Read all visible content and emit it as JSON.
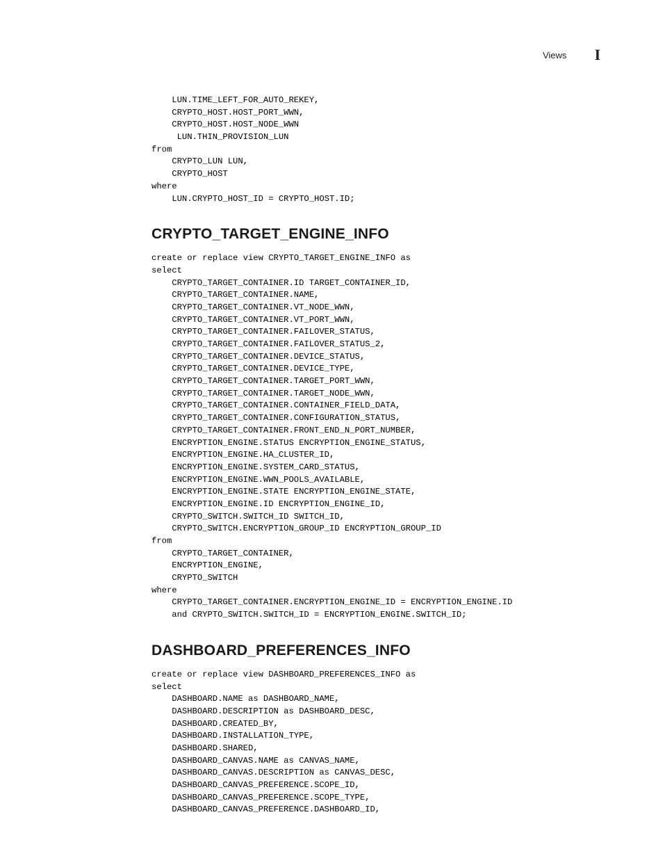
{
  "header": {
    "label": "Views",
    "badge": "I"
  },
  "block1": "    LUN.TIME_LEFT_FOR_AUTO_REKEY,\n    CRYPTO_HOST.HOST_PORT_WWN,\n    CRYPTO_HOST.HOST_NODE_WWN\n     LUN.THIN_PROVISION_LUN\nfrom\n    CRYPTO_LUN LUN,\n    CRYPTO_HOST\nwhere\n    LUN.CRYPTO_HOST_ID = CRYPTO_HOST.ID;",
  "heading1": "CRYPTO_TARGET_ENGINE_INFO",
  "block2": "create or replace view CRYPTO_TARGET_ENGINE_INFO as\nselect\n    CRYPTO_TARGET_CONTAINER.ID TARGET_CONTAINER_ID,\n    CRYPTO_TARGET_CONTAINER.NAME,\n    CRYPTO_TARGET_CONTAINER.VT_NODE_WWN,\n    CRYPTO_TARGET_CONTAINER.VT_PORT_WWN,\n    CRYPTO_TARGET_CONTAINER.FAILOVER_STATUS,\n    CRYPTO_TARGET_CONTAINER.FAILOVER_STATUS_2,\n    CRYPTO_TARGET_CONTAINER.DEVICE_STATUS,\n    CRYPTO_TARGET_CONTAINER.DEVICE_TYPE,\n    CRYPTO_TARGET_CONTAINER.TARGET_PORT_WWN,\n    CRYPTO_TARGET_CONTAINER.TARGET_NODE_WWN,\n    CRYPTO_TARGET_CONTAINER.CONTAINER_FIELD_DATA,\n    CRYPTO_TARGET_CONTAINER.CONFIGURATION_STATUS,\n    CRYPTO_TARGET_CONTAINER.FRONT_END_N_PORT_NUMBER,\n    ENCRYPTION_ENGINE.STATUS ENCRYPTION_ENGINE_STATUS,\n    ENCRYPTION_ENGINE.HA_CLUSTER_ID,\n    ENCRYPTION_ENGINE.SYSTEM_CARD_STATUS,\n    ENCRYPTION_ENGINE.WWN_POOLS_AVAILABLE,\n    ENCRYPTION_ENGINE.STATE ENCRYPTION_ENGINE_STATE,\n    ENCRYPTION_ENGINE.ID ENCRYPTION_ENGINE_ID,\n    CRYPTO_SWITCH.SWITCH_ID SWITCH_ID,\n    CRYPTO_SWITCH.ENCRYPTION_GROUP_ID ENCRYPTION_GROUP_ID\nfrom\n    CRYPTO_TARGET_CONTAINER,\n    ENCRYPTION_ENGINE,\n    CRYPTO_SWITCH\nwhere\n    CRYPTO_TARGET_CONTAINER.ENCRYPTION_ENGINE_ID = ENCRYPTION_ENGINE.ID\n    and CRYPTO_SWITCH.SWITCH_ID = ENCRYPTION_ENGINE.SWITCH_ID;",
  "heading2": "DASHBOARD_PREFERENCES_INFO",
  "block3": "create or replace view DASHBOARD_PREFERENCES_INFO as\nselect\n    DASHBOARD.NAME as DASHBOARD_NAME,\n    DASHBOARD.DESCRIPTION as DASHBOARD_DESC,\n    DASHBOARD.CREATED_BY,\n    DASHBOARD.INSTALLATION_TYPE,\n    DASHBOARD.SHARED,\n    DASHBOARD_CANVAS.NAME as CANVAS_NAME,\n    DASHBOARD_CANVAS.DESCRIPTION as CANVAS_DESC,\n    DASHBOARD_CANVAS_PREFERENCE.SCOPE_ID,\n    DASHBOARD_CANVAS_PREFERENCE.SCOPE_TYPE,\n    DASHBOARD_CANVAS_PREFERENCE.DASHBOARD_ID,"
}
